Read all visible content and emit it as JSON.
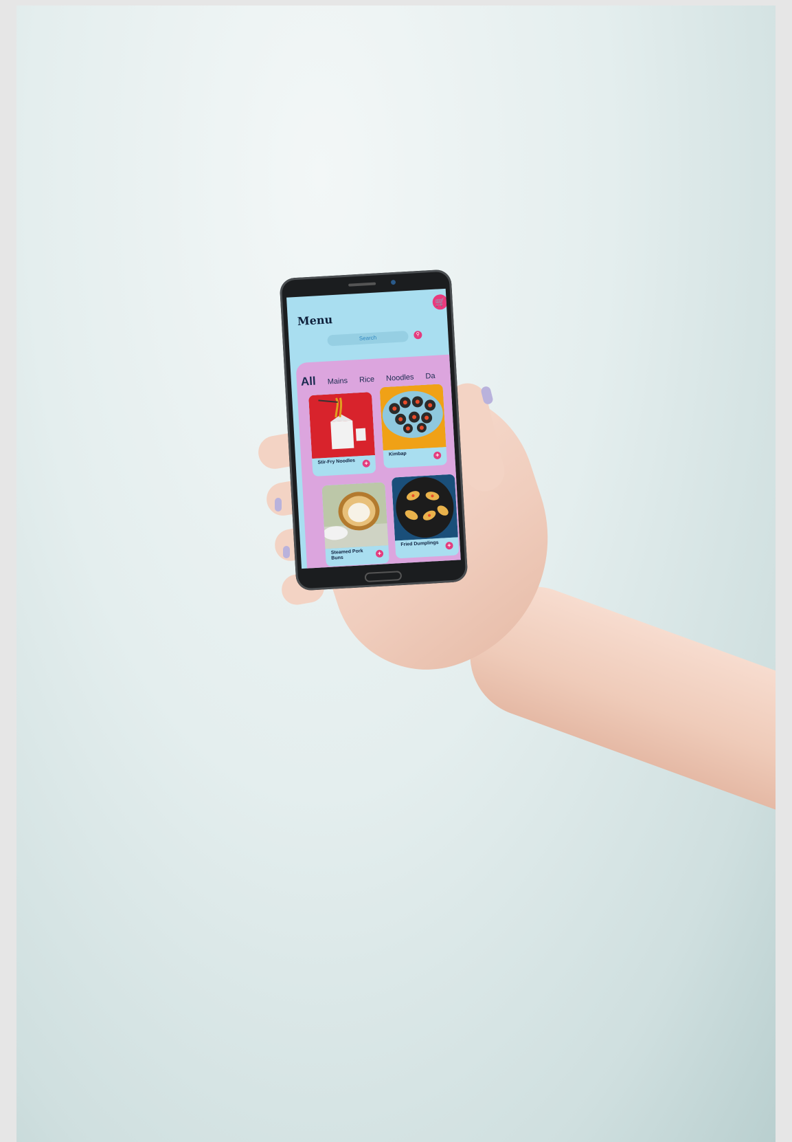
{
  "app": {
    "title": "Menu",
    "search_placeholder": "Search"
  },
  "icons": {
    "cart": "shopping-cart-icon",
    "search": "search-icon",
    "add": "plus-icon"
  },
  "tabs": [
    "All",
    "Mains",
    "Rice",
    "Noodles",
    "Da"
  ],
  "active_tab": "All",
  "items": [
    {
      "name": "Stir-Fry Noodles"
    },
    {
      "name": "Kimbap"
    },
    {
      "name": "Steamed Pork Buns"
    },
    {
      "name": "Fried Dumplings"
    }
  ],
  "colors": {
    "screen_bg": "#a9def0",
    "panel": "#dca5de",
    "accent": "#e33c7e",
    "title": "#0e1f3a"
  }
}
